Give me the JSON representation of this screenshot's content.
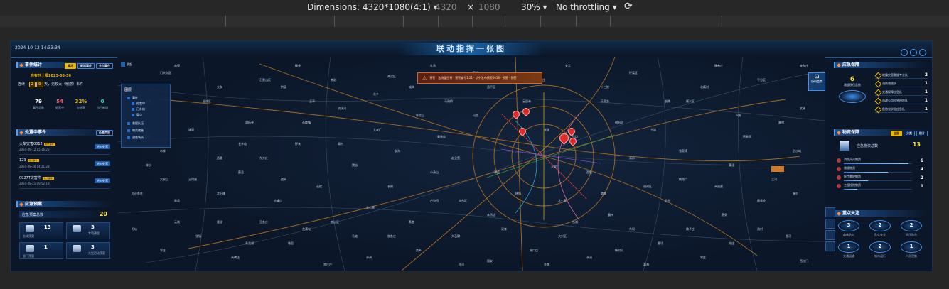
{
  "devtools": {
    "dimensions_label": "Dimensions: 4320*1080(4:1)",
    "width": "4320",
    "times": "×",
    "height": "1080",
    "zoom": "30%",
    "throttling": "No throttling"
  },
  "header": {
    "title": "联动指挥一张图",
    "datetime": "2024-10-12 14:33:34"
  },
  "event_stats": {
    "title": "事件统计",
    "tabs": [
      "概况",
      "新闻事件",
      "全市事件"
    ],
    "date_line": "自有时上报2023-05-30",
    "safe_prefix": "连续",
    "safe_days": [
      "2",
      "0"
    ],
    "safe_suffix": "天，无较大（敏感）事件",
    "stats": [
      {
        "value": "79",
        "label": "事件总数",
        "color": "#ffffff"
      },
      {
        "value": "54",
        "label": "处置中",
        "color": "#ff5a5a"
      },
      {
        "value": "32%",
        "label": "办结率",
        "color": "#f0b400"
      },
      {
        "value": "0",
        "label": "当日新增",
        "color": "#3fe0a0"
      }
    ]
  },
  "handling_events": {
    "title": "处置中事件",
    "filter": "处置类别",
    "items": [
      {
        "name": "火车灾害0012",
        "level": "较大事件",
        "date": "2024-09-12 15:16:25",
        "action": "进入处置"
      },
      {
        "name": "123",
        "level": "较大事件",
        "date": "2024-09-30 14:21:28",
        "action": "进入处置"
      },
      {
        "name": "0927T灾害件",
        "level": "较大事件",
        "date": "2024-09-21 09:52:19",
        "action": "进入处置"
      }
    ]
  },
  "plans": {
    "title": "应急预案",
    "total_label": "应急预案总数",
    "total": "20",
    "cards": [
      {
        "value": "13",
        "label": "总体预案"
      },
      {
        "value": "3",
        "label": "专项预案"
      },
      {
        "value": "1",
        "label": "部门预案"
      },
      {
        "value": "3",
        "label": "大型活动预案"
      }
    ]
  },
  "map": {
    "legend_title": "图层",
    "legend_items": [
      "事件",
      "处置中",
      "已办结",
      "重点",
      "救援队伍",
      "物资储备",
      "避难场所"
    ],
    "collapse_label": "收起",
    "alert_text": "预警：这测重回预 · 预警编号1.21 · 华中发布预警0019 · 预警 · 预警",
    "cooperation": "协同会商",
    "capital_label": "天安门",
    "place_labels": [
      "门头沟区",
      "石景山区",
      "海淀区",
      "丰台区",
      "房山区",
      "大兴区",
      "通州区",
      "朝阳区",
      "昌平区",
      "顺义区",
      "怀柔区",
      "延庆区",
      "平谷区",
      "密云区",
      "良乡",
      "长阳",
      "燕郊",
      "廊坊",
      "固安",
      "涿州",
      "三河",
      "香河",
      "永清",
      "武清",
      "霸州",
      "雄县",
      "高碑店",
      "易县",
      "涞水",
      "涞源",
      "蔚县",
      "怀来",
      "琉璃河",
      "窦店",
      "青云店",
      "马驹桥",
      "采育",
      "于家务",
      "张家湾",
      "宋庄",
      "后沙峪",
      "高丽营",
      "北七家",
      "小汤山",
      "阳坊",
      "南口",
      "妙峰山",
      "王平",
      "斋堂",
      "清水",
      "雁翅",
      "军庄",
      "潭柘寺",
      "大灰厂",
      "河西",
      "云居寺",
      "张坊",
      "十渡",
      "蒲洼",
      "霞云岭",
      "佛子庄",
      "韩村河",
      "周口店",
      "大石窝",
      "长沟",
      "石楼",
      "东方红",
      "太和",
      "榆垡",
      "礼贤",
      "安定",
      "魏善庄",
      "庞各庄",
      "北臧村",
      "黄村",
      "旧宫",
      "亦庄",
      "西红门",
      "瀛海",
      "台湖",
      "永乐店",
      "漷县",
      "西集",
      "潞城",
      "杨镇",
      "李遂",
      "赵全营",
      "北小营",
      "龙湾屯",
      "张镇",
      "大孙各庄",
      "木林",
      "北石槽",
      "南彩",
      "马坡",
      "牛栏山",
      "高岭",
      "溪翁庄",
      "十三陵",
      "长陵",
      "兴寿",
      "崔村",
      "流村",
      "桃峪口",
      "东坝",
      "金盏",
      "孙河",
      "崔各庄",
      "黑庄户",
      "豆各庄",
      "王四营",
      "十八里店",
      "南苑",
      "花乡",
      "卢沟桥",
      "宛平",
      "长辛店",
      "王佐",
      "云岗",
      "青龙湖",
      "石楼镇",
      "阎村",
      "城关",
      "拱辰",
      "西潞",
      "大安山",
      "史家营",
      "南窖",
      "新镇",
      "坨里",
      "紫荆关",
      "杨家坪",
      "千军台",
      "灵山"
    ]
  },
  "rescue_teams": {
    "title": "应急保障",
    "total": "6",
    "total_label": "救援队伍总数",
    "items": [
      {
        "name": "地震灾害救援专业队",
        "count": "2"
      },
      {
        "name": "消防救援队",
        "count": "1"
      },
      {
        "name": "交通保障应急队",
        "count": "1"
      },
      {
        "name": "市政公用应急抢险队",
        "count": "1"
      },
      {
        "name": "危险化学品应急队",
        "count": "1"
      }
    ]
  },
  "materials": {
    "title": "物资保障",
    "tabs": [
      "全部",
      "分类",
      "统计"
    ],
    "total_label": "应急物资总数",
    "total": "13",
    "items": [
      {
        "name": "消防灭火物资",
        "count": "6",
        "pct": 0.95
      },
      {
        "name": "救援物资",
        "count": "4",
        "pct": 0.65
      },
      {
        "name": "医疗救护物资",
        "count": "2",
        "pct": 0.35
      },
      {
        "name": "工程抢险物资",
        "count": "1",
        "pct": 0.2
      }
    ]
  },
  "focus": {
    "title": "重点关注",
    "items": [
      {
        "value": "3",
        "label": "森林防火"
      },
      {
        "value": "2",
        "label": "危化安全"
      },
      {
        "value": "2",
        "label": "防汛防台"
      },
      {
        "value": "1",
        "label": "交通运输"
      },
      {
        "value": "2",
        "label": "城市运行"
      },
      {
        "value": "1",
        "label": "人员密集"
      }
    ]
  }
}
